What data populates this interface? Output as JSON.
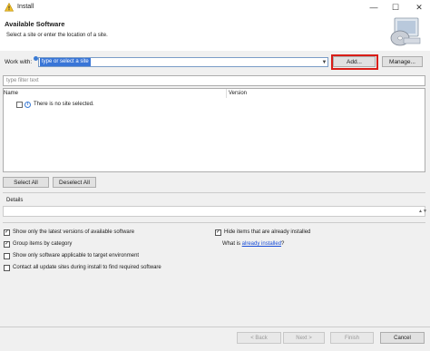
{
  "window": {
    "title": "Install",
    "minimize": "—",
    "maximize": "☐",
    "close": "✕"
  },
  "header": {
    "title": "Available Software",
    "subtitle": "Select a site or enter the location of a site."
  },
  "work_with": {
    "label": "Work with:",
    "value": "type or select a site",
    "add_label": "Add...",
    "manage_label": "Manage..."
  },
  "filter": {
    "placeholder": "type filter text"
  },
  "table": {
    "columns": [
      "Name",
      "Version"
    ],
    "rows": [
      {
        "name": "There is no site selected.",
        "version": ""
      }
    ]
  },
  "selection": {
    "select_all": "Select All",
    "deselect_all": "Deselect All"
  },
  "details": {
    "label": "Details"
  },
  "options": {
    "latest_versions": {
      "label": "Show only the latest versions of available software",
      "checked": true
    },
    "group_by_category": {
      "label": "Group items by category",
      "checked": true
    },
    "target_env": {
      "label": "Show only software applicable to target environment",
      "checked": false
    },
    "contact_sites": {
      "label": "Contact all update sites during install to find required software",
      "checked": false
    },
    "hide_installed": {
      "label": "Hide items that are already installed",
      "checked": true
    },
    "what_is_prefix": "What is ",
    "what_is_link": "already installed",
    "what_is_suffix": "?"
  },
  "footer": {
    "back": "< Back",
    "next": "Next >",
    "finish": "Finish",
    "cancel": "Cancel"
  },
  "colors": {
    "highlight": "#d91e18",
    "selection": "#3875d7",
    "link": "#1a4ed8"
  }
}
